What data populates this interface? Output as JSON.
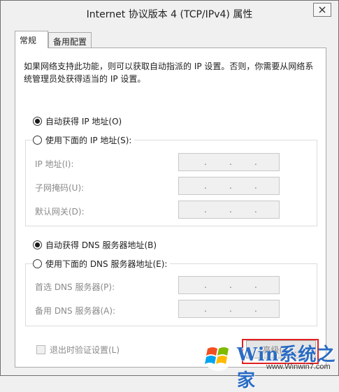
{
  "window": {
    "title": "Internet 协议版本 4 (TCP/IPv4) 属性"
  },
  "tabs": [
    {
      "label": "常规",
      "active": true
    },
    {
      "label": "备用配置",
      "active": false
    }
  ],
  "description": "如果网络支持此功能，则可以获取自动指派的 IP 设置。否则，你需要从网络系统管理员处获得适当的 IP 设置。",
  "ip_section": {
    "auto_label": "自动获得 IP 地址(O)",
    "auto_checked": true,
    "manual_label": "使用下面的 IP 地址(S):",
    "manual_checked": false,
    "fields": [
      {
        "label": "IP 地址(I):",
        "value": ""
      },
      {
        "label": "子网掩码(U):",
        "value": ""
      },
      {
        "label": "默认网关(D):",
        "value": ""
      }
    ]
  },
  "dns_section": {
    "auto_label": "自动获得 DNS 服务器地址(B)",
    "auto_checked": true,
    "manual_label": "使用下面的 DNS 服务器地址(E):",
    "manual_checked": false,
    "fields": [
      {
        "label": "首选 DNS 服务器(P):",
        "value": ""
      },
      {
        "label": "备用 DNS 服务器(A):",
        "value": ""
      }
    ]
  },
  "validate_checkbox": {
    "label": "退出时验证设置(L)",
    "checked": false
  },
  "advanced_button": {
    "label": "高级(V)..."
  },
  "watermark": {
    "brand": "Win系统之家",
    "url": "www.Winwin7.com"
  },
  "colors": {
    "highlight": "#e02020",
    "watermark_text": "#2a6cc4"
  }
}
